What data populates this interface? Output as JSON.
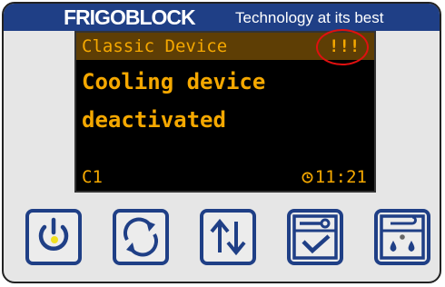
{
  "header": {
    "brand": "FRIGOBLOCK",
    "slogan": "Technology at its best"
  },
  "display": {
    "device_name": "Classic Device",
    "alert": "!!!",
    "message_line1": "Cooling device",
    "message_line2": "deactivated",
    "channel": "C1",
    "time": "11:21"
  },
  "buttons": [
    {
      "icon": "power-icon"
    },
    {
      "icon": "cycle-icon"
    },
    {
      "icon": "up-down-arrows-icon"
    },
    {
      "icon": "settings-check-icon"
    },
    {
      "icon": "defrost-icon"
    }
  ],
  "colors": {
    "brand_blue": "#1f3f86",
    "display_amber": "#f5a800",
    "alert_red": "#e01010",
    "power_indicator": "#f0e020"
  }
}
